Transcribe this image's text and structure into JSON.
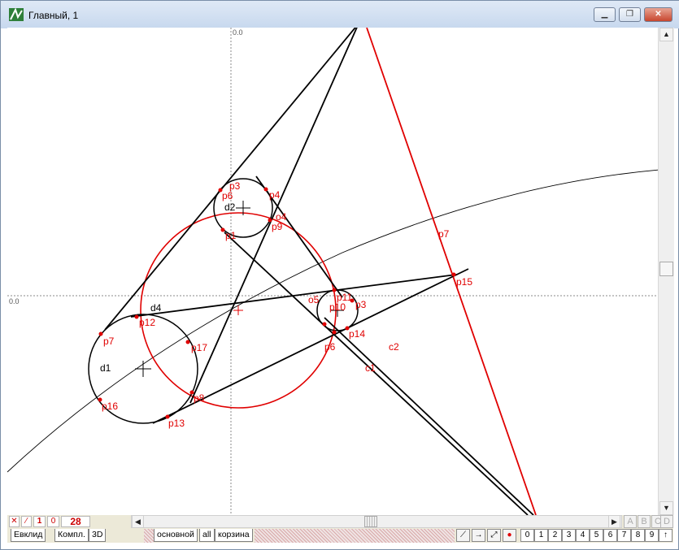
{
  "window": {
    "title": "Главный, 1"
  },
  "axes": {
    "x_label": "0.0",
    "y_label": "0.0"
  },
  "points": [
    "p3",
    "p4",
    "p5",
    "p6",
    "p7",
    "p8",
    "p9",
    "p10",
    "p11",
    "p12",
    "p13",
    "p14",
    "p15",
    "p16",
    "p17"
  ],
  "point_labels": {
    "p3a": "p3",
    "p6a": "p6",
    "p4": "p4",
    "p9": "p9",
    "p1": "p1",
    "p7": "p7",
    "p12": "p12",
    "p17": "p17",
    "p16": "p16",
    "p8": "p8",
    "p13": "p13",
    "p11": "p11",
    "p3b": "p3",
    "p10": "p10",
    "p14": "p14",
    "p6b": "p6",
    "p15": "p15"
  },
  "line_labels": {
    "d1": "d1",
    "d2": "d2",
    "d4": "d4",
    "c1": "c1",
    "c2": "c2",
    "c7": "p7",
    "c4": "o4",
    "c5": "o5",
    "c6": "p6",
    "c3": "o3"
  },
  "toolbar": {
    "count": "28",
    "mode_x": "✕",
    "mode_line": "⁄",
    "mode_1": "1",
    "mode_0": "0"
  },
  "tabs_left": [
    "Евклид",
    "Компл.",
    "3D"
  ],
  "tabs_layers": [
    "основной",
    "all",
    "корзина"
  ],
  "letters": [
    "A",
    "B",
    "C",
    "D"
  ],
  "numbers": [
    "0",
    "1",
    "2",
    "3",
    "4",
    "5",
    "6",
    "7",
    "8",
    "9"
  ],
  "up_arrow": "↑",
  "colors": {
    "red": "#e00000",
    "black": "#000000",
    "axis": "#888888"
  }
}
